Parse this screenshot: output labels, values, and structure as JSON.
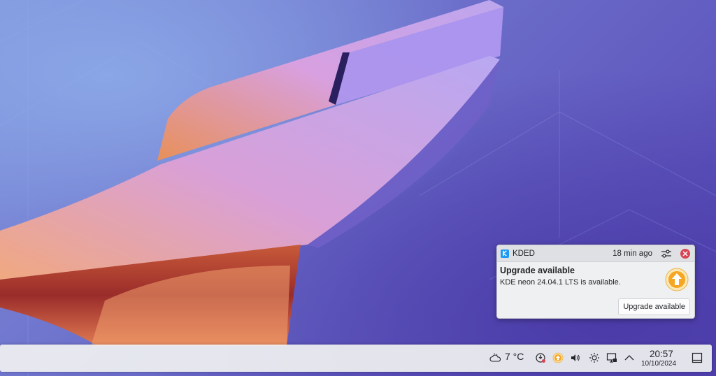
{
  "notification": {
    "app_name": "KDED",
    "time": "18 min ago",
    "title": "Upgrade available",
    "body": "KDE neon 24.04.1 LTS is available.",
    "action_label": "Upgrade available",
    "icons": {
      "app": "kde-icon",
      "settings": "sliders-icon",
      "close": "close-icon",
      "main": "upgrade-arrow-icon"
    }
  },
  "panel": {
    "weather": {
      "icon": "cloud-icon",
      "temperature": "7 °C"
    },
    "tray_icons": [
      "network-sync-icon",
      "update-icon",
      "volume-icon",
      "brightness-icon",
      "network-wired-icon",
      "chevron-up-icon"
    ],
    "clock": {
      "time": "20:57",
      "date": "10/10/2024"
    },
    "show_desktop_icon": "show-desktop-icon"
  },
  "colors": {
    "close": "#da4453",
    "kde_blue": "#1d99f3",
    "update_orange": "#f5a623"
  }
}
